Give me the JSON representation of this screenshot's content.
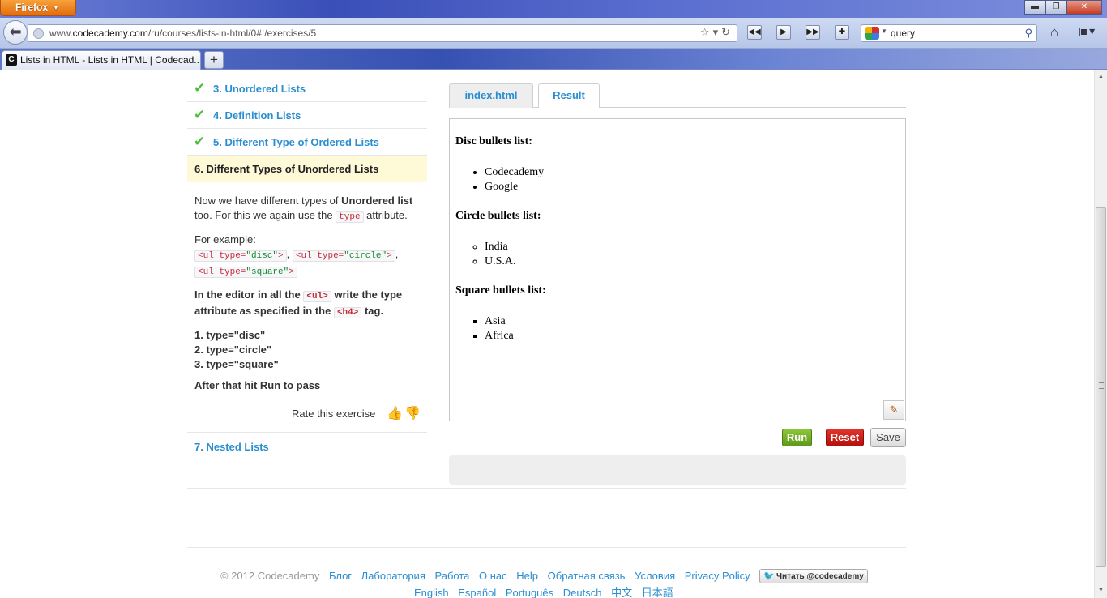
{
  "browser": {
    "menu_label": "Firefox",
    "url_prefix": "www.",
    "url_domain": "codecademy.com",
    "url_path": "/ru/courses/lists-in-html/0#!/exercises/5",
    "search_value": "query",
    "tab_title": "Lists in HTML - Lists in HTML | Codecad...",
    "tab_favicon": "C"
  },
  "lessons": [
    {
      "label": "3. Unordered Lists",
      "done": true
    },
    {
      "label": "4. Definition Lists",
      "done": true
    },
    {
      "label": "5. Different Type of Ordered Lists",
      "done": true
    },
    {
      "label": "6. Different Types of Unordered Lists",
      "active": true
    }
  ],
  "instructions": {
    "p1_a": "Now we have different types of ",
    "p1_b": "Unordered list",
    "p1_c": " too. For this we again use the ",
    "p1_code": "type",
    "p1_d": " attribute.",
    "p2_label": "For example:",
    "ex1_a": "<ul type=",
    "ex1_v": "\"disc\"",
    "ex1_b": ">",
    "ex2_a": "<ul type=",
    "ex2_v": "\"circle\"",
    "ex2_b": ">",
    "ex3_a": "<ul type=",
    "ex3_v": "\"square\"",
    "ex3_b": ">",
    "p3_a": "In the editor in all the ",
    "p3_code1": "<ul>",
    "p3_b": " write the type attribute as specified in the ",
    "p3_code2": "<h4>",
    "p3_c": " tag.",
    "steps": [
      "1.  type=\"disc\"",
      "2.  type=\"circle\"",
      "3.  type=\"square\""
    ],
    "after": "After that hit Run to pass"
  },
  "rate_label": "Rate this exercise",
  "next_lesson": "7. Nested Lists",
  "editor_tabs": [
    "index.html",
    "Result"
  ],
  "result": {
    "h1": "Disc bullets list:",
    "list1": [
      "Codecademy",
      "Google"
    ],
    "h2": "Circle bullets list:",
    "list2": [
      "India",
      "U.S.A."
    ],
    "h3": "Square bullets list:",
    "list3": [
      "Asia",
      "Africa"
    ]
  },
  "buttons": {
    "run": "Run",
    "reset": "Reset",
    "save": "Save"
  },
  "footer": {
    "copyright": "© 2012 Codecademy",
    "links1": [
      "Блог",
      "Лаборатория",
      "Работа",
      "О нас",
      "Help",
      "Обратная связь",
      "Условия",
      "Privacy Policy"
    ],
    "twitter": "Читать @codecademy",
    "links2": [
      "English",
      "Español",
      "Português",
      "Deutsch",
      "中文",
      "日本語"
    ]
  },
  "colors": {
    "accent": "#2a8ed0",
    "check": "#4cbf3b",
    "run": "#6aa820",
    "reset": "#c81810",
    "active_bg": "#fef9d7"
  }
}
